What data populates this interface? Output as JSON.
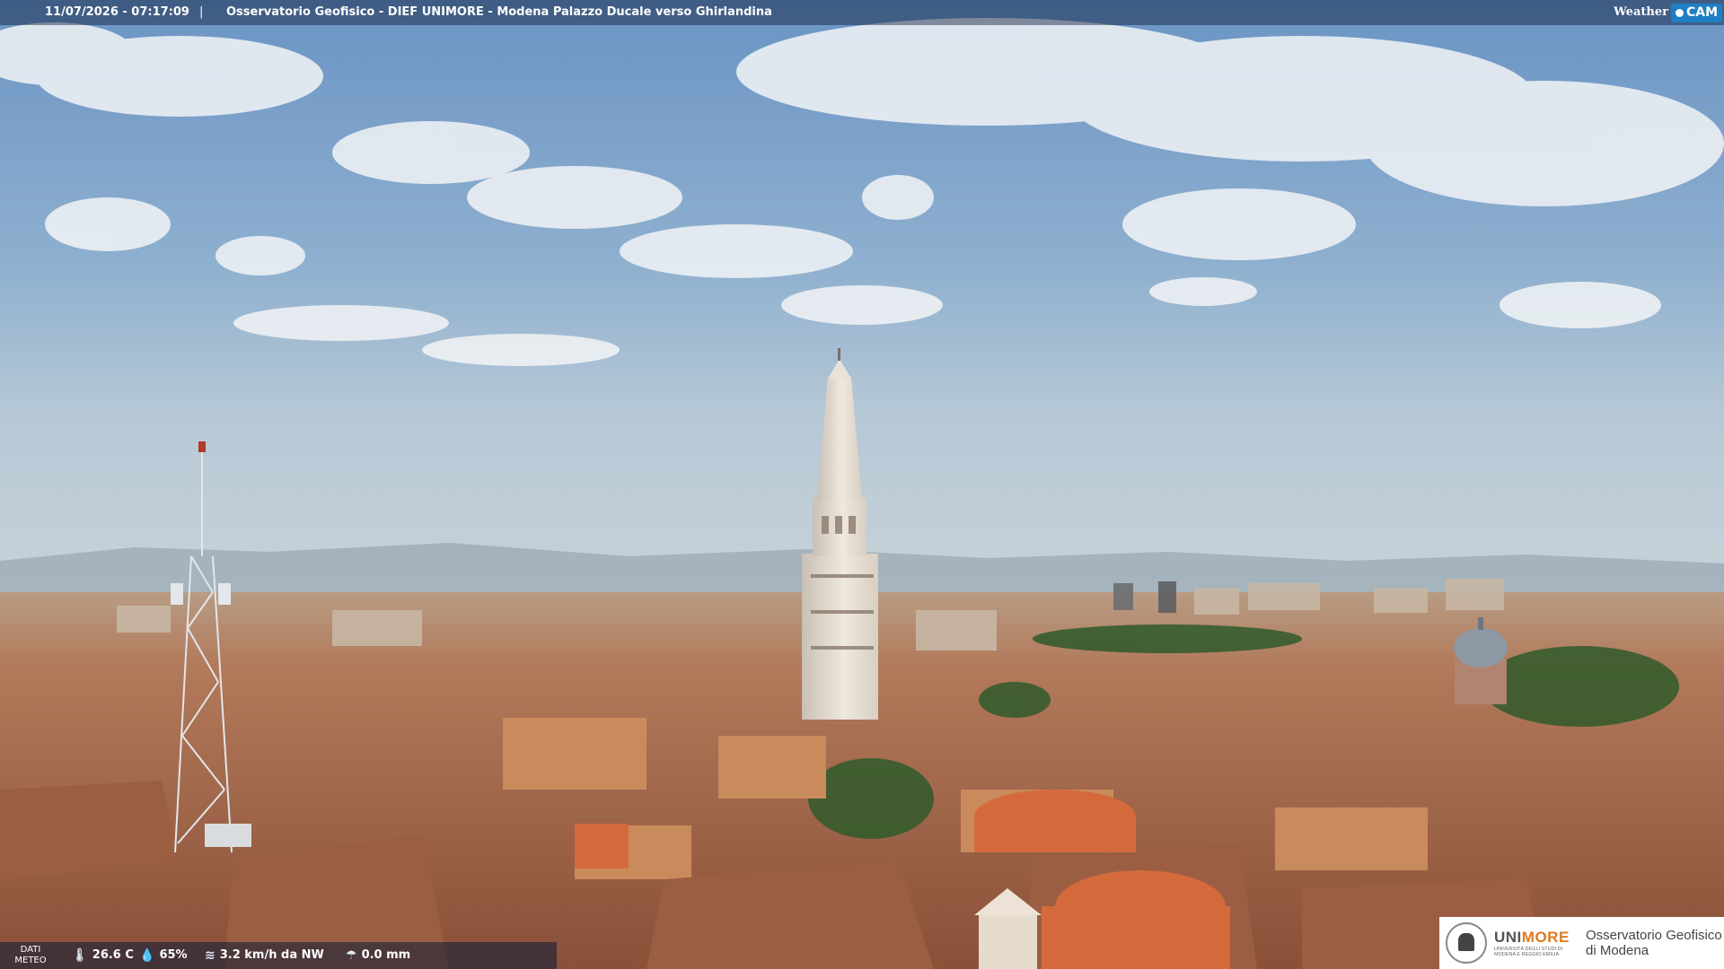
{
  "header": {
    "timestamp": "11/07/2026 - 07:17:09",
    "separator": "|",
    "caption": "Osservatorio Geofisico - DIEF UNIMORE - Modena Palazzo Ducale verso Ghirlandina",
    "brand_weather": "Weather",
    "brand_cam": "CAM"
  },
  "meteo": {
    "label_line1": "DATI",
    "label_line2": "METEO",
    "temperature": "26.6 C",
    "humidity": "65%",
    "wind": "3.2 km/h da NW",
    "rain": "0.0 mm",
    "icons": {
      "temperature": "thermometer-icon",
      "humidity": "drop-icon",
      "wind": "wind-icon",
      "rain": "umbrella-icon"
    }
  },
  "logo": {
    "uni_prefix": "UNI",
    "uni_suffix": "MORE",
    "uni_sub": "UNIVERSITÀ DEGLI STUDI DI MODENA E REGGIO EMILIA",
    "obs_line1": "Osservatorio Geofisico",
    "obs_line2": "di Modena"
  },
  "colors": {
    "sky_top": "#6e97c6",
    "sky_horizon": "#b7cad8",
    "roof": "#a46a4c",
    "unimore_orange": "#e07a1f",
    "cam_blue": "#1f7fc4"
  }
}
